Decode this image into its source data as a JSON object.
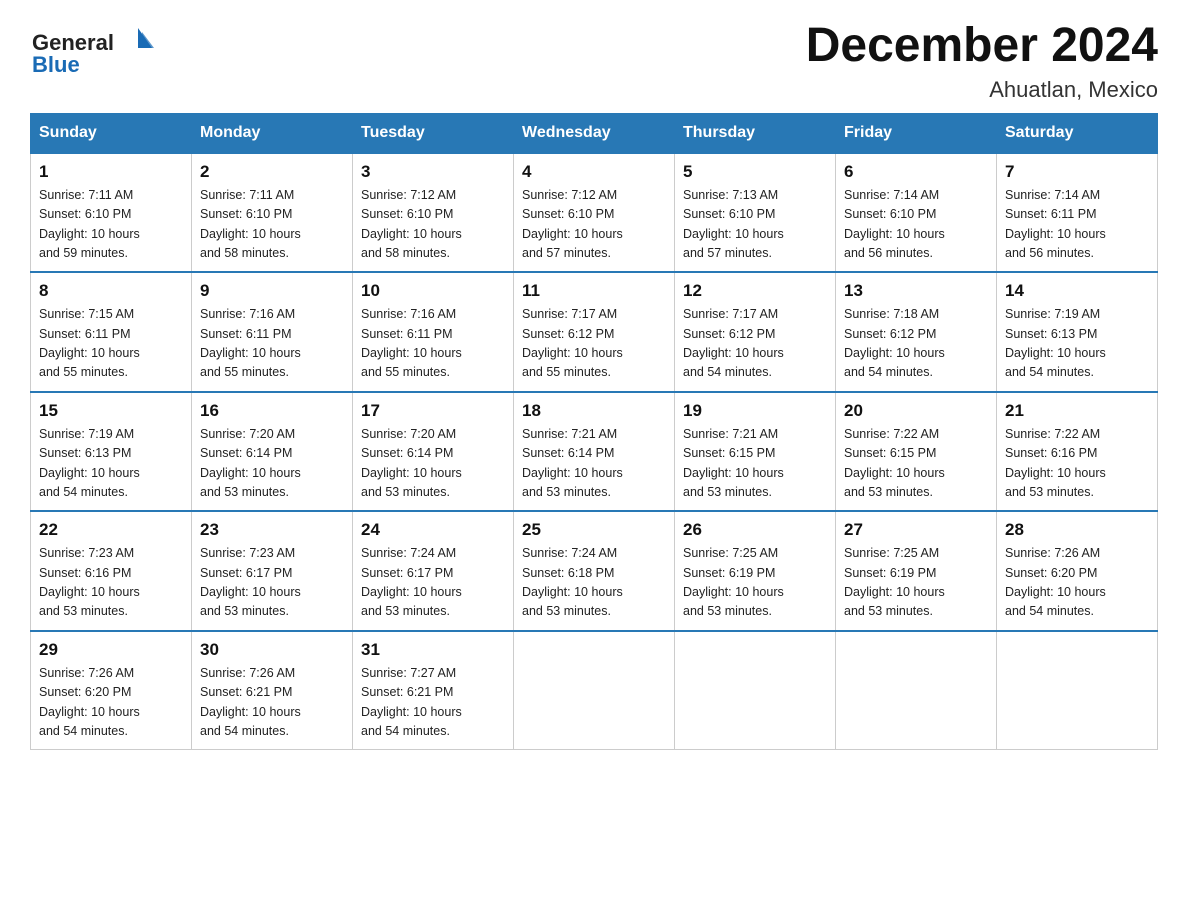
{
  "header": {
    "title": "December 2024",
    "location": "Ahuatlan, Mexico",
    "logo_general": "General",
    "logo_blue": "Blue"
  },
  "calendar": {
    "days_of_week": [
      "Sunday",
      "Monday",
      "Tuesday",
      "Wednesday",
      "Thursday",
      "Friday",
      "Saturday"
    ],
    "weeks": [
      [
        {
          "day": "1",
          "sunrise": "7:11 AM",
          "sunset": "6:10 PM",
          "daylight": "10 hours and 59 minutes."
        },
        {
          "day": "2",
          "sunrise": "7:11 AM",
          "sunset": "6:10 PM",
          "daylight": "10 hours and 58 minutes."
        },
        {
          "day": "3",
          "sunrise": "7:12 AM",
          "sunset": "6:10 PM",
          "daylight": "10 hours and 58 minutes."
        },
        {
          "day": "4",
          "sunrise": "7:12 AM",
          "sunset": "6:10 PM",
          "daylight": "10 hours and 57 minutes."
        },
        {
          "day": "5",
          "sunrise": "7:13 AM",
          "sunset": "6:10 PM",
          "daylight": "10 hours and 57 minutes."
        },
        {
          "day": "6",
          "sunrise": "7:14 AM",
          "sunset": "6:10 PM",
          "daylight": "10 hours and 56 minutes."
        },
        {
          "day": "7",
          "sunrise": "7:14 AM",
          "sunset": "6:11 PM",
          "daylight": "10 hours and 56 minutes."
        }
      ],
      [
        {
          "day": "8",
          "sunrise": "7:15 AM",
          "sunset": "6:11 PM",
          "daylight": "10 hours and 55 minutes."
        },
        {
          "day": "9",
          "sunrise": "7:16 AM",
          "sunset": "6:11 PM",
          "daylight": "10 hours and 55 minutes."
        },
        {
          "day": "10",
          "sunrise": "7:16 AM",
          "sunset": "6:11 PM",
          "daylight": "10 hours and 55 minutes."
        },
        {
          "day": "11",
          "sunrise": "7:17 AM",
          "sunset": "6:12 PM",
          "daylight": "10 hours and 55 minutes."
        },
        {
          "day": "12",
          "sunrise": "7:17 AM",
          "sunset": "6:12 PM",
          "daylight": "10 hours and 54 minutes."
        },
        {
          "day": "13",
          "sunrise": "7:18 AM",
          "sunset": "6:12 PM",
          "daylight": "10 hours and 54 minutes."
        },
        {
          "day": "14",
          "sunrise": "7:19 AM",
          "sunset": "6:13 PM",
          "daylight": "10 hours and 54 minutes."
        }
      ],
      [
        {
          "day": "15",
          "sunrise": "7:19 AM",
          "sunset": "6:13 PM",
          "daylight": "10 hours and 54 minutes."
        },
        {
          "day": "16",
          "sunrise": "7:20 AM",
          "sunset": "6:14 PM",
          "daylight": "10 hours and 53 minutes."
        },
        {
          "day": "17",
          "sunrise": "7:20 AM",
          "sunset": "6:14 PM",
          "daylight": "10 hours and 53 minutes."
        },
        {
          "day": "18",
          "sunrise": "7:21 AM",
          "sunset": "6:14 PM",
          "daylight": "10 hours and 53 minutes."
        },
        {
          "day": "19",
          "sunrise": "7:21 AM",
          "sunset": "6:15 PM",
          "daylight": "10 hours and 53 minutes."
        },
        {
          "day": "20",
          "sunrise": "7:22 AM",
          "sunset": "6:15 PM",
          "daylight": "10 hours and 53 minutes."
        },
        {
          "day": "21",
          "sunrise": "7:22 AM",
          "sunset": "6:16 PM",
          "daylight": "10 hours and 53 minutes."
        }
      ],
      [
        {
          "day": "22",
          "sunrise": "7:23 AM",
          "sunset": "6:16 PM",
          "daylight": "10 hours and 53 minutes."
        },
        {
          "day": "23",
          "sunrise": "7:23 AM",
          "sunset": "6:17 PM",
          "daylight": "10 hours and 53 minutes."
        },
        {
          "day": "24",
          "sunrise": "7:24 AM",
          "sunset": "6:17 PM",
          "daylight": "10 hours and 53 minutes."
        },
        {
          "day": "25",
          "sunrise": "7:24 AM",
          "sunset": "6:18 PM",
          "daylight": "10 hours and 53 minutes."
        },
        {
          "day": "26",
          "sunrise": "7:25 AM",
          "sunset": "6:19 PM",
          "daylight": "10 hours and 53 minutes."
        },
        {
          "day": "27",
          "sunrise": "7:25 AM",
          "sunset": "6:19 PM",
          "daylight": "10 hours and 53 minutes."
        },
        {
          "day": "28",
          "sunrise": "7:26 AM",
          "sunset": "6:20 PM",
          "daylight": "10 hours and 54 minutes."
        }
      ],
      [
        {
          "day": "29",
          "sunrise": "7:26 AM",
          "sunset": "6:20 PM",
          "daylight": "10 hours and 54 minutes."
        },
        {
          "day": "30",
          "sunrise": "7:26 AM",
          "sunset": "6:21 PM",
          "daylight": "10 hours and 54 minutes."
        },
        {
          "day": "31",
          "sunrise": "7:27 AM",
          "sunset": "6:21 PM",
          "daylight": "10 hours and 54 minutes."
        },
        null,
        null,
        null,
        null
      ]
    ],
    "labels": {
      "sunrise": "Sunrise:",
      "sunset": "Sunset:",
      "daylight": "Daylight:"
    }
  }
}
